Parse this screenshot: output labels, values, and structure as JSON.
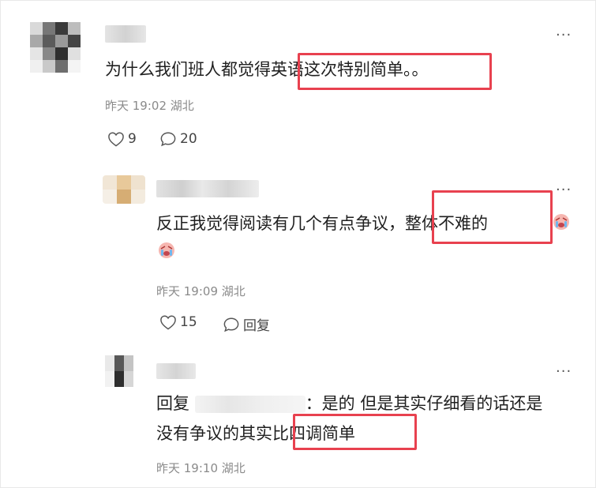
{
  "comments": [
    {
      "text": "为什么我们班人都觉得英语这次特别简单。。",
      "time": "昨天 19:02",
      "location": "湖北",
      "likes": "9",
      "replies": "20"
    },
    {
      "text_line1": "反正我觉得阅读有几个有点争议，整体不难的",
      "time": "昨天 19:09",
      "location": "湖北",
      "likes": "15",
      "reply_label": "回复"
    },
    {
      "reply_prefix": "回复",
      "text_line1_rest": "：是的 但是其实仔细看的话还是",
      "text_line2": "没有争议的其实比四调简单",
      "time": "昨天 19:10",
      "location": "湖北"
    }
  ],
  "colors": {
    "highlight": "#e8414f",
    "meta": "#8a8a8a",
    "text": "#1f1f1f"
  },
  "icons": {
    "like": "heart-outline-icon",
    "comment": "speech-bubble-icon",
    "more": "more-dots-icon",
    "emoji": "crying-face-emoji"
  }
}
